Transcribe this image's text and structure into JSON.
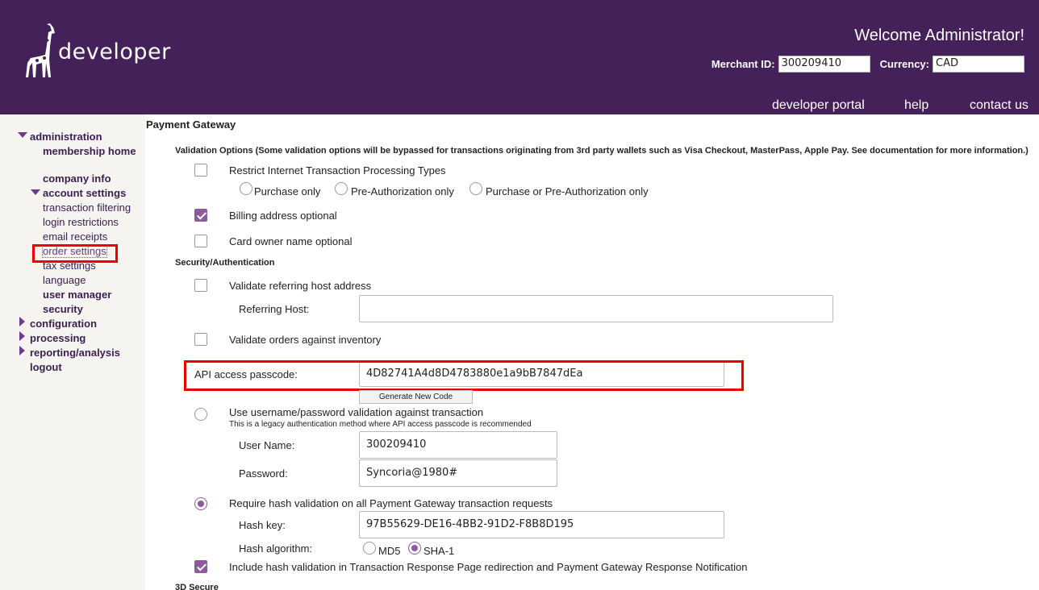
{
  "header": {
    "logo_text": "developer",
    "welcome": "Welcome Administrator!",
    "merchant_id_label": "Merchant ID:",
    "merchant_id_value": "300209410",
    "currency_label": "Currency:",
    "currency_value": "CAD",
    "nav": [
      "developer portal",
      "help",
      "contact us"
    ]
  },
  "sidebar": {
    "administration": "administration",
    "membership_home": "membership home",
    "company_info": "company info",
    "account_settings": "account settings",
    "transaction_filtering": "transaction filtering",
    "login_restrictions": "login restrictions",
    "email_receipts": "email receipts",
    "order_settings": "order settings",
    "tax_settings": "tax settings",
    "language": "language",
    "user_manager": "user manager",
    "security": "security",
    "configuration": "configuration",
    "processing": "processing",
    "reporting_analysis": "reporting/analysis",
    "logout": "logout"
  },
  "main": {
    "title": "Payment Gateway",
    "validation_options": "Validation Options  (Some validation options will be bypassed for transactions originating from 3rd party wallets such as Visa Checkout, MasterPass, Apple Pay. See documentation for more information.)",
    "restrict_types": "Restrict Internet Transaction Processing Types",
    "purchase_only": "Purchase only",
    "preauth_only": "Pre-Authorization only",
    "purchase_or_preauth": "Purchase or Pre-Authorization only",
    "billing_optional": "Billing address optional",
    "card_owner_optional": "Card owner name optional",
    "security_auth": "Security/Authentication",
    "validate_host": "Validate referring host address",
    "referring_host_label": "Referring Host:",
    "referring_host_value": "",
    "validate_inventory": "Validate orders against inventory",
    "api_label": "API access passcode:",
    "api_value": "4D82741A4d8D4783880e1a9bB7847dEa",
    "generate_btn": "Generate New Code",
    "use_username": "Use username/password validation against transaction",
    "legacy_note": "This is a legacy authentication method where API access passcode is recommended",
    "username_label": "User Name:",
    "username_value": "300209410",
    "password_label": "Password:",
    "password_value": "Syncoria@1980#",
    "require_hash": "Require hash validation on all Payment Gateway transaction requests",
    "hash_key_label": "Hash key:",
    "hash_key_value": "97B55629-DE16-4BB2-91D2-F8B8D195",
    "hash_algo_label": "Hash algorithm:",
    "md5": "MD5",
    "sha1": "SHA-1",
    "include_hash": "Include hash validation in Transaction Response Page redirection and Payment Gateway Response Notification",
    "secure3d": "3D Secure"
  },
  "colors": {
    "header_bg": "#45215a",
    "accent": "#8e5a9f",
    "highlight": "#ee0000"
  }
}
